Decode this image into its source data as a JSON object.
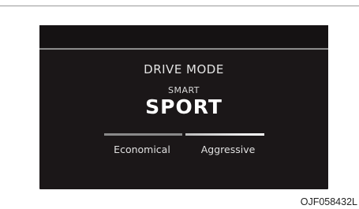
{
  "display": {
    "title": "DRIVE MODE",
    "mode_subtitle": "SMART",
    "mode_name": "SPORT",
    "gauge": {
      "left_label": "Economical",
      "right_label": "Aggressive"
    }
  },
  "figure_code": "OJF058432L",
  "colors": {
    "display_background": "#1b1718",
    "text": "#e3e3e3",
    "active_gauge": "#ffffff",
    "inactive_gauge": "#8a8a8a"
  }
}
